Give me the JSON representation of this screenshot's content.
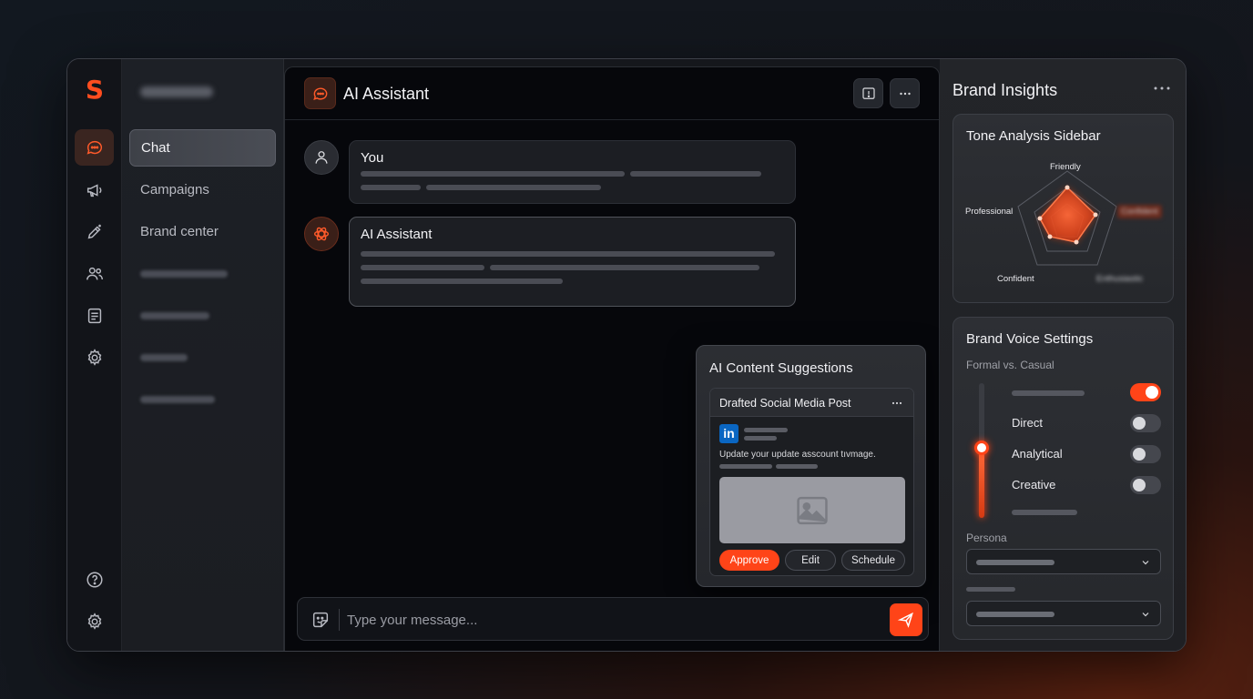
{
  "app": {
    "logo": "S"
  },
  "nav": {
    "items": [
      {
        "label": "Chat",
        "active": true
      },
      {
        "label": "Campaigns"
      },
      {
        "label": "Brand center"
      }
    ]
  },
  "main": {
    "title": "AI Assistant",
    "messages": [
      {
        "author": "You"
      },
      {
        "author": "AI Assistant"
      }
    ],
    "composer_placeholder": "Type your message..."
  },
  "suggestions": {
    "title": "AI Content Suggestions",
    "post": {
      "title": "Drafted Social Media Post",
      "network_badge": "in",
      "text": "Update your update asscount tıvmage.",
      "actions": [
        "Approve",
        "Edit",
        "Schedule"
      ]
    }
  },
  "insights": {
    "title": "Brand Insights",
    "tone": {
      "title": "Tone Analysis Sidebar",
      "labels": {
        "top": "Friendly",
        "left": "Professional",
        "right": "Confident",
        "bottom_left": "Confident",
        "bottom_right": "Enthusiastic"
      }
    },
    "voice": {
      "title": "Brand Voice Settings",
      "formal_label": "Formal vs. Casual",
      "slider_level": 0.52,
      "options": [
        {
          "label": "",
          "on": true
        },
        {
          "label": "Direct",
          "on": false
        },
        {
          "label": "Analytical",
          "on": false
        },
        {
          "label": "Creative",
          "on": false
        }
      ],
      "persona_label": "Persona"
    }
  },
  "colors": {
    "accent": "#ff4418",
    "panel": "#15171c",
    "linkedin": "#0a66c2"
  }
}
